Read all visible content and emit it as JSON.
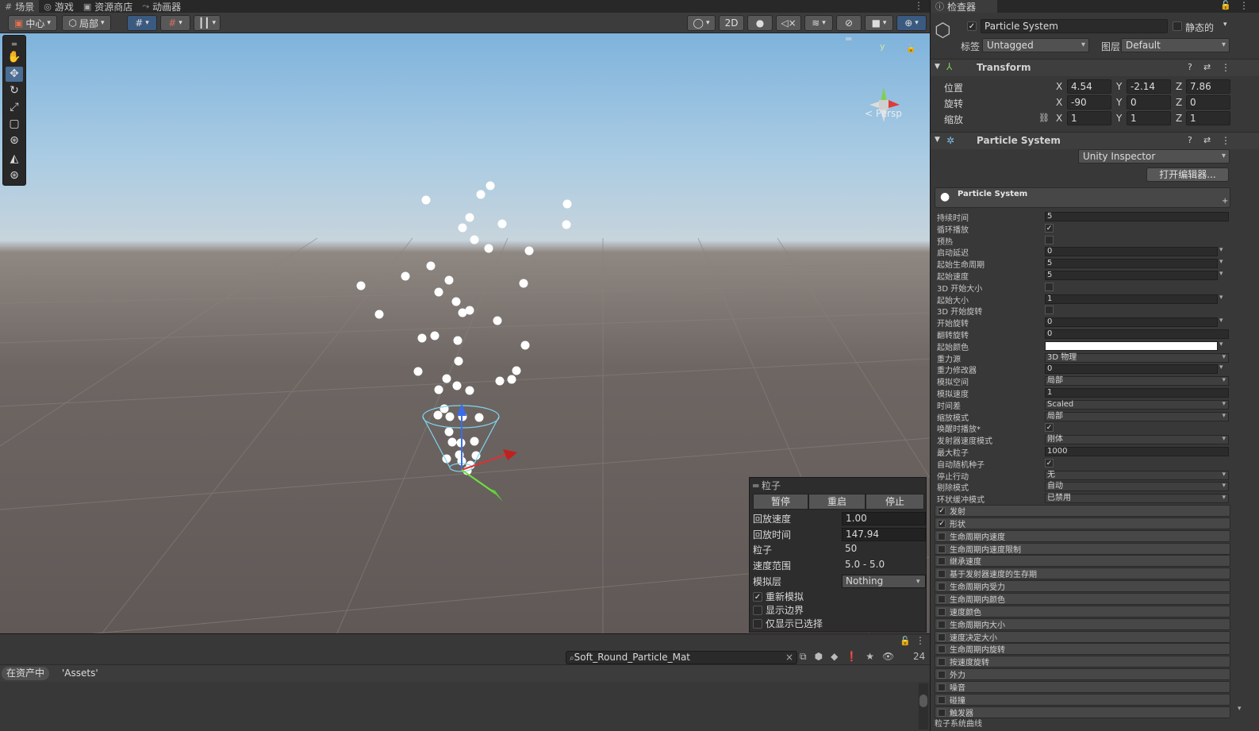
{
  "tabs": [
    {
      "icon": "#",
      "label": "场景"
    },
    {
      "icon": "◎",
      "label": "游戏"
    },
    {
      "icon": "▣",
      "label": "资源商店"
    },
    {
      "icon": "⤳",
      "label": "动画器"
    }
  ],
  "scene_toolbar": {
    "pivot": "中心",
    "space": "局部",
    "mode_2d": "2D"
  },
  "gizmo": {
    "persp_label": "< Persp",
    "axis_y": "y"
  },
  "particle_panel": {
    "title": "粒子",
    "pause": "暂停",
    "restart": "重启",
    "stop": "停止",
    "rows": [
      {
        "label": "回放速度",
        "value": "1.00"
      },
      {
        "label": "回放时间",
        "value": "147.94"
      },
      {
        "label": "粒子",
        "value": "50"
      },
      {
        "label": "速度范围",
        "value": "5.0 - 5.0"
      },
      {
        "label": "模拟层",
        "value": "Nothing"
      }
    ],
    "resimulate": "重新模拟",
    "show_bounds": "显示边界",
    "only_selected": "仅显示已选择"
  },
  "project": {
    "search_value": "Soft_Round_Particle_Mat",
    "count": "24",
    "in_assets": "在资产中",
    "assets_label": "'Assets'"
  },
  "inspector": {
    "tab_title": "检查器",
    "object_name": "Particle System",
    "static_label": "静态的",
    "tag_label": "标签",
    "tag_value": "Untagged",
    "layer_label": "图层",
    "layer_value": "Default",
    "transform_title": "Transform",
    "position_label": "位置",
    "rotation_label": "旋转",
    "scale_label": "缩放",
    "position": {
      "x": "4.54",
      "y": "-2.14",
      "z": "7.86"
    },
    "rotation": {
      "x": "-90",
      "y": "0",
      "z": "0"
    },
    "scale": {
      "x": "1",
      "y": "1",
      "z": "1"
    },
    "ps_title": "Particle System",
    "inspector_mode": "Unity Inspector",
    "open_editor": "打开编辑器...",
    "module_header": "Particle System",
    "main_props": [
      {
        "label": "持续时间",
        "type": "field",
        "value": "5"
      },
      {
        "label": "循环播放",
        "type": "check",
        "value": "✓"
      },
      {
        "label": "预热",
        "type": "check",
        "value": ""
      },
      {
        "label": "启动延迟",
        "type": "field_arrow",
        "value": "0"
      },
      {
        "label": "起始生命周期",
        "type": "field_arrow",
        "value": "5"
      },
      {
        "label": "起始速度",
        "type": "field_arrow",
        "value": "5"
      },
      {
        "label": "3D 开始大小",
        "type": "check",
        "value": ""
      },
      {
        "label": "起始大小",
        "type": "field_arrow",
        "value": "1"
      },
      {
        "label": "3D 开始旋转",
        "type": "check",
        "value": ""
      },
      {
        "label": "开始旋转",
        "type": "field_arrow",
        "value": "0"
      },
      {
        "label": "翻转旋转",
        "type": "field",
        "value": "0"
      },
      {
        "label": "起始颜色",
        "type": "color",
        "value": ""
      },
      {
        "label": "重力源",
        "type": "drop",
        "value": "3D 物理"
      },
      {
        "label": "重力修改器",
        "type": "field_arrow",
        "value": "0"
      },
      {
        "label": "模拟空间",
        "type": "drop",
        "value": "局部"
      },
      {
        "label": "模拟速度",
        "type": "field",
        "value": "1"
      },
      {
        "label": "时间差",
        "type": "drop",
        "value": "Scaled"
      },
      {
        "label": "缩放模式",
        "type": "drop",
        "value": "局部"
      },
      {
        "label": "唤醒时播放*",
        "type": "check",
        "value": "✓"
      },
      {
        "label": "发射器速度模式",
        "type": "drop",
        "value": "刚体"
      },
      {
        "label": "最大粒子",
        "type": "field",
        "value": "1000"
      },
      {
        "label": "自动随机种子",
        "type": "check",
        "value": "✓"
      },
      {
        "label": "停止行动",
        "type": "drop",
        "value": "无"
      },
      {
        "label": "剔除模式",
        "type": "drop",
        "value": "自动"
      },
      {
        "label": "环状缓冲模式",
        "type": "drop",
        "value": "已禁用"
      }
    ],
    "modules": [
      {
        "label": "发射",
        "checked": "✓"
      },
      {
        "label": "形状",
        "checked": "✓"
      },
      {
        "label": "生命周期内速度",
        "checked": ""
      },
      {
        "label": "生命周期内速度限制",
        "checked": ""
      },
      {
        "label": "继承速度",
        "checked": ""
      },
      {
        "label": "基于发射器速度的生存期",
        "checked": ""
      },
      {
        "label": "生命周期内受力",
        "checked": ""
      },
      {
        "label": "生命周期内颜色",
        "checked": ""
      },
      {
        "label": "速度颜色",
        "checked": ""
      },
      {
        "label": "生命周期内大小",
        "checked": ""
      },
      {
        "label": "速度决定大小",
        "checked": ""
      },
      {
        "label": "生命周期内旋转",
        "checked": ""
      },
      {
        "label": "按速度旋转",
        "checked": ""
      },
      {
        "label": "外力",
        "checked": ""
      },
      {
        "label": "噪音",
        "checked": ""
      },
      {
        "label": "碰撞",
        "checked": ""
      },
      {
        "label": "触发器",
        "checked": ""
      }
    ],
    "curves_label": "粒子系统曲线"
  },
  "colors": {
    "sky_top": "#7fb3dc",
    "ground": "#6e6663",
    "accent": "#4a6d96"
  }
}
